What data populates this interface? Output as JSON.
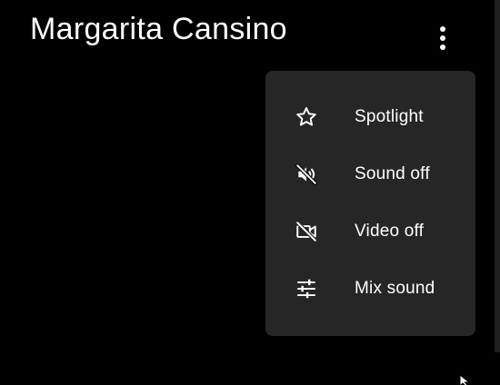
{
  "participant": {
    "name": "Margarita Cansino"
  },
  "more_button": {
    "icon": "more-vertical-icon"
  },
  "menu": {
    "items": [
      {
        "label": "Spotlight",
        "icon": "star-outline-icon"
      },
      {
        "label": "Sound off",
        "icon": "volume-off-icon"
      },
      {
        "label": "Video off",
        "icon": "video-off-icon"
      },
      {
        "label": "Mix sound",
        "icon": "tune-sliders-icon"
      }
    ]
  },
  "colors": {
    "background": "#000000",
    "menu_background": "#262626",
    "text": "#ffffff"
  }
}
